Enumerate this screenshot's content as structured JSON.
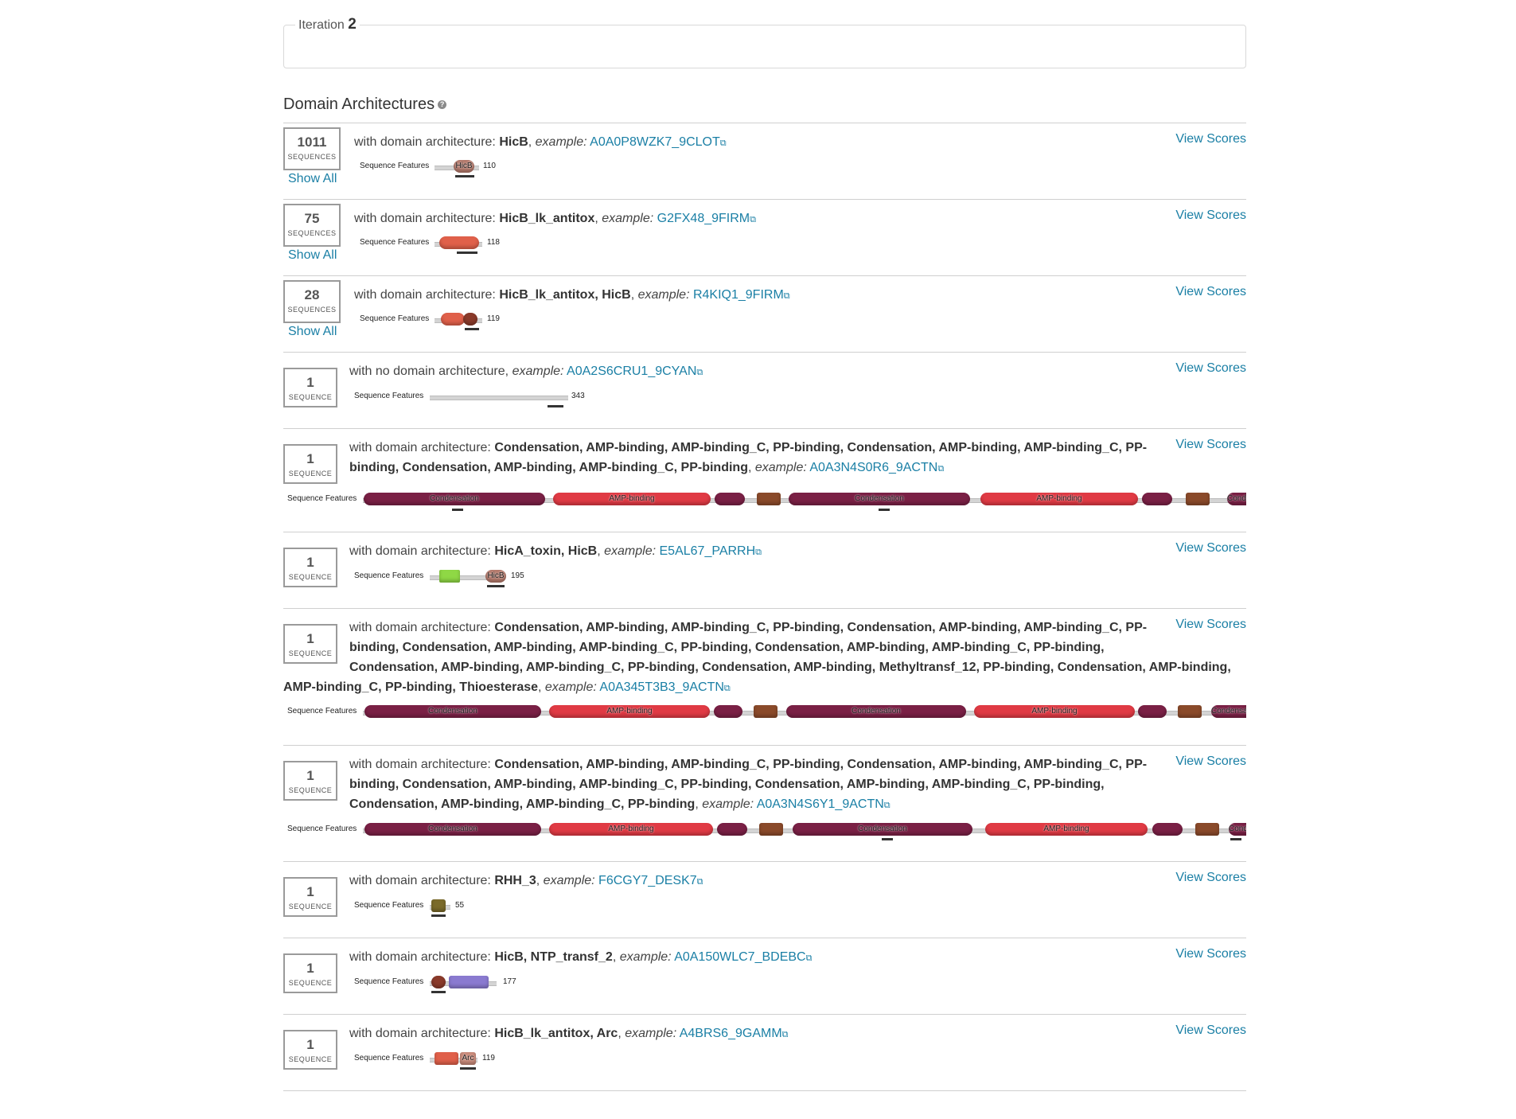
{
  "iteration": {
    "label": "Iteration",
    "number": "2"
  },
  "section": {
    "title": "Domain Architectures",
    "help": "?"
  },
  "common": {
    "view_scores": "View Scores",
    "show_all": "Show All",
    "seq_features": "Sequence Features",
    "arch_prefix": "with domain architecture: ",
    "example": "example:"
  },
  "colors": {
    "hicb": "#a06a5e",
    "condensation": "#7a2045",
    "amp_binding": "#e03a44",
    "amp_binding_c": "#7a2045",
    "pp_binding": "#8a4a2a",
    "hica_toxin": "#8fd845",
    "rhh_3": "#7a6a2a",
    "ntp_transf_2": "#6a5ab0",
    "hicb_lk_antitox": "#e0604a",
    "arc": "#c98a7a",
    "link": "#1a7fa5"
  },
  "rows": [
    {
      "count": "1011",
      "unit": "SEQUENCES",
      "show_all": true,
      "arch": "HicB",
      "example_id": "A0A0P8WZK7_9CLOT",
      "length": "110",
      "domains": [
        "HicB"
      ]
    },
    {
      "count": "75",
      "unit": "SEQUENCES",
      "show_all": true,
      "arch": "HicB_lk_antitox",
      "example_id": "G2FX48_9FIRM",
      "length": "118",
      "domains": []
    },
    {
      "count": "28",
      "unit": "SEQUENCES",
      "show_all": true,
      "arch": "HicB_lk_antitox, HicB",
      "example_id": "R4KIQ1_9FIRM",
      "length": "119",
      "domains": []
    },
    {
      "count": "1",
      "unit": "SEQUENCE",
      "show_all": false,
      "no_arch_text": "with no domain architecture,",
      "arch": "",
      "example_id": "A0A2S6CRU1_9CYAN",
      "length": "343",
      "domains": []
    },
    {
      "count": "1",
      "unit": "SEQUENCE",
      "show_all": false,
      "arch_line1": "Condensation, AMP-binding, AMP-binding_C, PP-binding, Condensation, AMP-binding, AMP-binding_C, PP-",
      "arch_line2": "binding, Condensation, AMP-binding, AMP-binding_C, PP-binding",
      "example_id": "A0A3N4S0R6_9ACTN",
      "domains": [
        "Condensation",
        "AMP-binding",
        "Condensation",
        "AMP-binding",
        "Condensation"
      ]
    },
    {
      "count": "1",
      "unit": "SEQUENCE",
      "show_all": false,
      "arch": "HicA_toxin, HicB",
      "example_id": "E5AL67_PARRH",
      "length": "195",
      "domains": [
        "HicB"
      ]
    },
    {
      "count": "1",
      "unit": "SEQUENCE",
      "show_all": false,
      "arch_line1": "Condensation, AMP-binding, AMP-binding_C, PP-binding, Condensation, AMP-binding, AMP-binding_C, PP-",
      "arch_line2": "binding, Condensation, AMP-binding, AMP-binding_C, PP-binding, Condensation, AMP-binding, AMP-binding_C, PP-binding,",
      "arch_line3": "Condensation, AMP-binding, AMP-binding_C, PP-binding, Condensation, AMP-binding, Methyltransf_12, PP-binding, Condensation, AMP-binding,",
      "arch_line4": "AMP-binding_C, PP-binding, Thioesterase",
      "example_id": "A0A345T3B3_9ACTN",
      "domains": [
        "Condensation",
        "AMP-binding",
        "Condensation",
        "AMP-binding",
        "Condensation"
      ]
    },
    {
      "count": "1",
      "unit": "SEQUENCE",
      "show_all": false,
      "arch_line1": "Condensation, AMP-binding, AMP-binding_C, PP-binding, Condensation, AMP-binding, AMP-binding_C, PP-",
      "arch_line2": "binding, Condensation, AMP-binding, AMP-binding_C, PP-binding, Condensation, AMP-binding, AMP-binding_C, PP-binding,",
      "arch_line3": "Condensation, AMP-binding, AMP-binding_C, PP-binding",
      "example_id": "A0A3N4S6Y1_9ACTN",
      "domains": [
        "Condensation",
        "AMP-binding",
        "Condensation",
        "AMP-binding",
        "Condensation"
      ]
    },
    {
      "count": "1",
      "unit": "SEQUENCE",
      "show_all": false,
      "arch": "RHH_3",
      "example_id": "F6CGY7_DESK7",
      "length": "55",
      "domains": []
    },
    {
      "count": "1",
      "unit": "SEQUENCE",
      "show_all": false,
      "arch": "HicB, NTP_transf_2",
      "example_id": "A0A150WLC7_BDEBC",
      "length": "177",
      "domains": []
    },
    {
      "count": "1",
      "unit": "SEQUENCE",
      "show_all": false,
      "arch": "HicB_lk_antitox, Arc",
      "example_id": "A4BRS6_9GAMM",
      "length": "119",
      "domains": [
        "Arc"
      ]
    }
  ]
}
